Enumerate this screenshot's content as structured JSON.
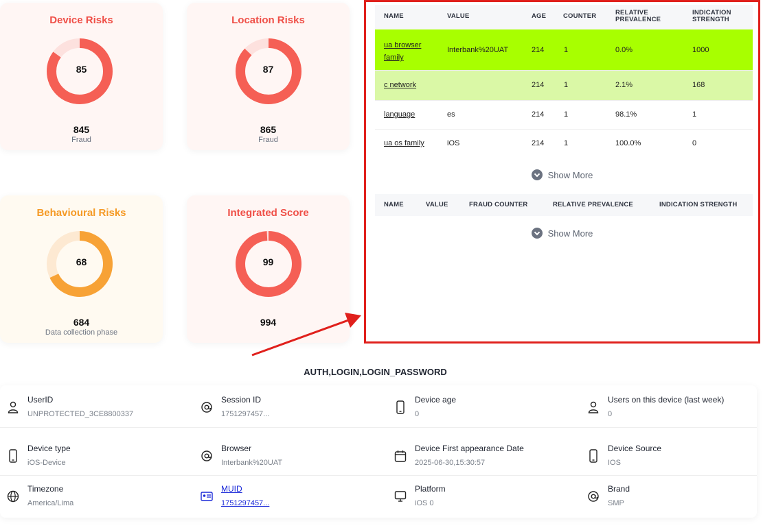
{
  "risk_cards": [
    {
      "title": "Device Risks",
      "score": "85",
      "count": "845",
      "sub": "Fraud",
      "score_value": 85,
      "accent": "#f55f55",
      "track": "#fde1de"
    },
    {
      "title": "Location Risks",
      "score": "87",
      "count": "865",
      "sub": "Fraud",
      "score_value": 87,
      "accent": "#f55f55",
      "track": "#fde1de"
    },
    {
      "title": "Behavioural Risks",
      "score": "68",
      "count": "684",
      "sub": "Data collection phase",
      "score_value": 68,
      "accent": "#f7a236",
      "track": "#fde9d2"
    },
    {
      "title": "Integrated Score",
      "score": "99",
      "count": "994",
      "sub": "",
      "score_value": 99,
      "accent": "#f55f55",
      "track": "#fde1de"
    }
  ],
  "indicators_table": {
    "headers": [
      "NAME",
      "VALUE",
      "AGE",
      "COUNTER",
      "RELATIVE PREVALENCE",
      "INDICATION STRENGTH"
    ],
    "rows": [
      {
        "name": "ua browser family",
        "value": "Interbank%20UAT",
        "age": "214",
        "counter": "1",
        "prevalence": "0.0%",
        "strength": "1000"
      },
      {
        "name": "c network",
        "value": "",
        "age": "214",
        "counter": "1",
        "prevalence": "2.1%",
        "strength": "168"
      },
      {
        "name": "language",
        "value": "es",
        "age": "214",
        "counter": "1",
        "prevalence": "98.1%",
        "strength": "1"
      },
      {
        "name": "ua os family",
        "value": "iOS",
        "age": "214",
        "counter": "1",
        "prevalence": "100.0%",
        "strength": "0"
      }
    ],
    "show_more": "Show More"
  },
  "fraud_table": {
    "headers": [
      "NAME",
      "VALUE",
      "FRAUD COUNTER",
      "RELATIVE PREVALENCE",
      "INDICATION STRENGTH"
    ],
    "show_more": "Show More"
  },
  "auth_label": "AUTH,LOGIN,LOGIN_PASSWORD",
  "info": [
    {
      "icon": "user-icon",
      "label": "UserID",
      "value": "UNPROTECTED_3CE8800337"
    },
    {
      "icon": "at-icon",
      "label": "Session ID",
      "value": "1751297457..."
    },
    {
      "icon": "phone-icon",
      "label": "Device age",
      "value": "0"
    },
    {
      "icon": "user-icon",
      "label": "Users on this device (last week)",
      "value": "0"
    },
    {
      "icon": "phone-icon",
      "label": "Device type",
      "value": "iOS-Device"
    },
    {
      "icon": "at-icon",
      "label": "Browser",
      "value": "Interbank%20UAT"
    },
    {
      "icon": "calendar-icon",
      "label": "Device First appearance Date",
      "value": "2025-06-30,15:30:57"
    },
    {
      "icon": "phone-icon",
      "label": "Device Source",
      "value": "IOS"
    },
    {
      "icon": "globe-icon",
      "label": "Timezone",
      "value": "America/Lima"
    },
    {
      "icon": "id-card-icon",
      "label": "MUID",
      "value": "1751297457..."
    },
    {
      "icon": "monitor-icon",
      "label": "Platform",
      "value": "iOS 0"
    },
    {
      "icon": "at-icon",
      "label": "Brand",
      "value": "SMP"
    }
  ],
  "colors": {
    "highlight_strong": "#a8ff00",
    "highlight_light": "#daf8a6",
    "annotation": "#e0201c",
    "link": "#1b2ad8"
  }
}
